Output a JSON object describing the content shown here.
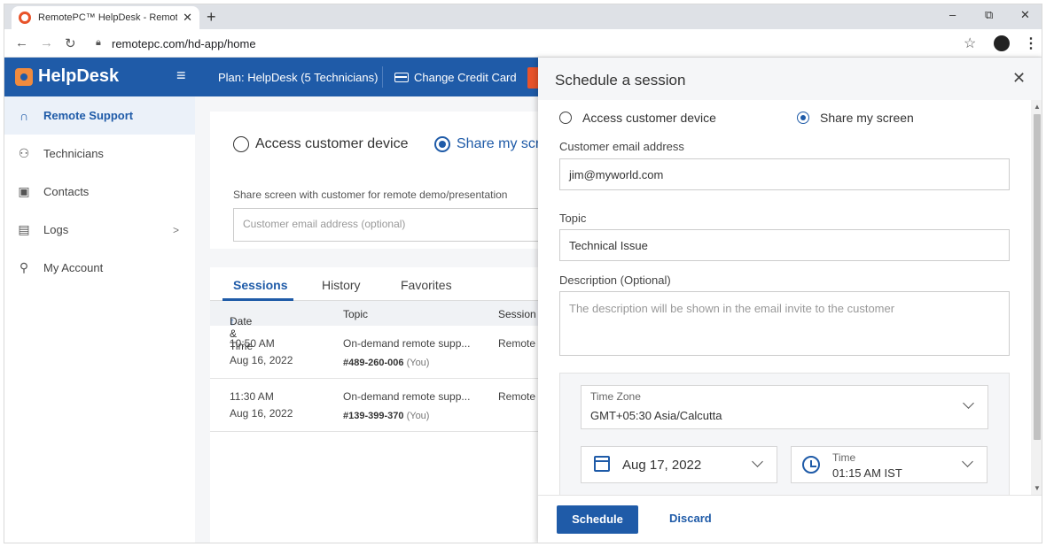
{
  "browser": {
    "tab_title": "RemotePC™ HelpDesk - Remote",
    "new_tab": "+",
    "url": "remotepc.com/hd-app/home",
    "window_controls": [
      "–",
      "⧉",
      "✕"
    ]
  },
  "app": {
    "brand": "HelpDesk",
    "plan": "Plan: HelpDesk (5 Technicians)",
    "change_card": "Change Credit Card",
    "accent_color": "#1f5ba8"
  },
  "sidebar": {
    "items": [
      {
        "label": "Remote Support",
        "icon": "headset-icon"
      },
      {
        "label": "Technicians",
        "icon": "technicians-icon"
      },
      {
        "label": "Contacts",
        "icon": "contacts-icon"
      },
      {
        "label": "Logs",
        "icon": "logs-icon"
      },
      {
        "label": "My Account",
        "icon": "user-icon"
      }
    ]
  },
  "main": {
    "option_access": "Access customer device",
    "option_share": "Share my scr",
    "hint": "Share screen with customer for remote demo/presentation",
    "email_placeholder": "Customer email address (optional)",
    "tabs": [
      "Sessions",
      "History",
      "Favorites"
    ],
    "columns": [
      "Date & Time",
      "Topic",
      "Session"
    ],
    "rows": [
      {
        "time": "10:50 AM",
        "date": "Aug 16, 2022",
        "topic": "On-demand remote supp...",
        "id": "#489-260-006",
        "you": "(You)",
        "session": "Remote"
      },
      {
        "time": "11:30 AM",
        "date": "Aug 16, 2022",
        "topic": "On-demand remote supp...",
        "id": "#139-399-370",
        "you": "(You)",
        "session": "Remote"
      }
    ]
  },
  "modal": {
    "title": "Schedule a session",
    "option_access": "Access customer device",
    "option_share": "Share my screen",
    "email_label": "Customer email address",
    "email_value": "jim@myworld.com",
    "topic_label": "Topic",
    "topic_value": "Technical Issue",
    "desc_label": "Description (Optional)",
    "desc_placeholder": "The description will be shown in the email invite to the customer",
    "timezone_label": "Time Zone",
    "timezone_value": "GMT+05:30 Asia/Calcutta",
    "date_value": "Aug 17, 2022",
    "time_label": "Time",
    "time_value": "01:15 AM IST",
    "schedule_btn": "Schedule",
    "discard_btn": "Discard"
  }
}
